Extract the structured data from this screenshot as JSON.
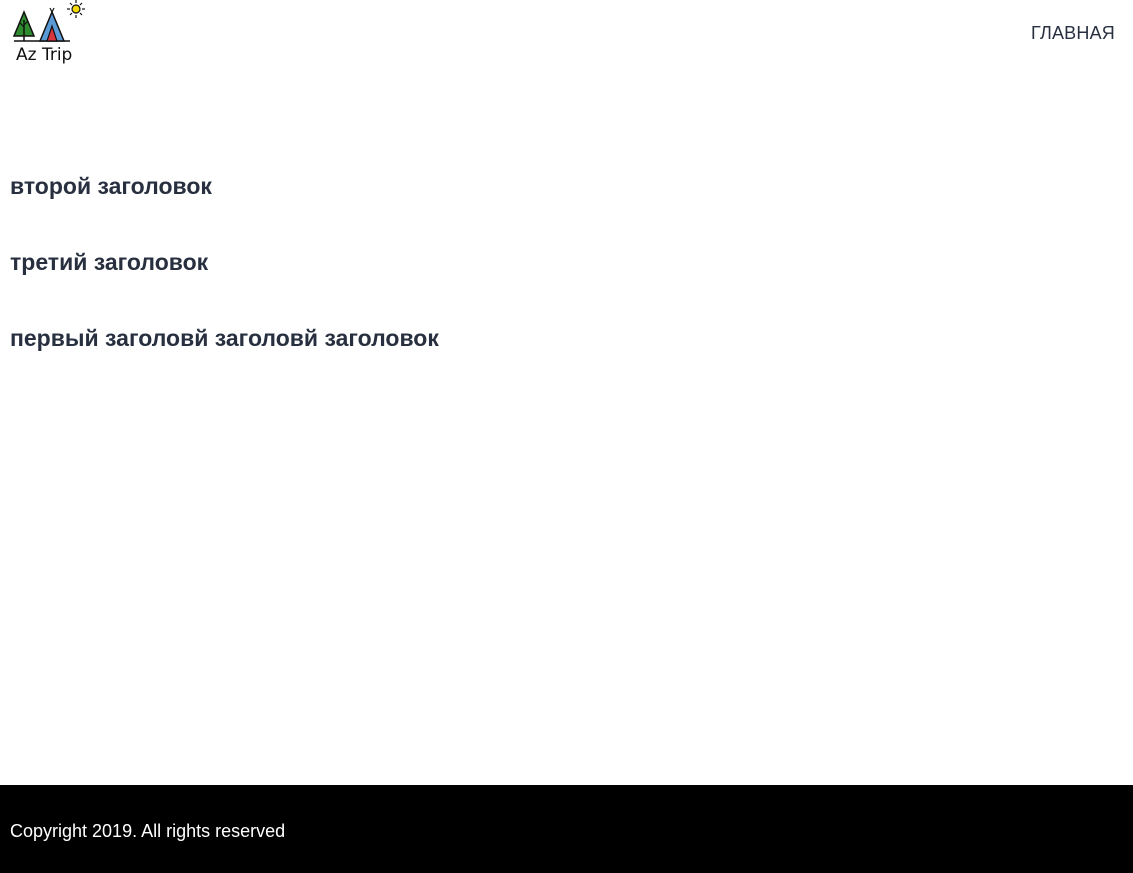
{
  "header": {
    "logo_text": "Az Trip",
    "nav": {
      "home_label": "ГЛАВНАЯ"
    }
  },
  "main": {
    "headings": [
      "второй заголовок",
      "третий заголовок",
      "первый заголовй заголовй заголовок"
    ]
  },
  "footer": {
    "copyright": "Copyright 2019. All rights reserved"
  },
  "colors": {
    "text": "#283040",
    "footer_bg": "#000000",
    "footer_text": "#ffffff",
    "tree_green": "#2e8b2e",
    "tent_blue": "#5b9bd5",
    "tent_red": "#d9363e",
    "sun_yellow": "#f5d90a"
  },
  "icons": {
    "logo": "tent-tree-sun-logo-icon"
  }
}
